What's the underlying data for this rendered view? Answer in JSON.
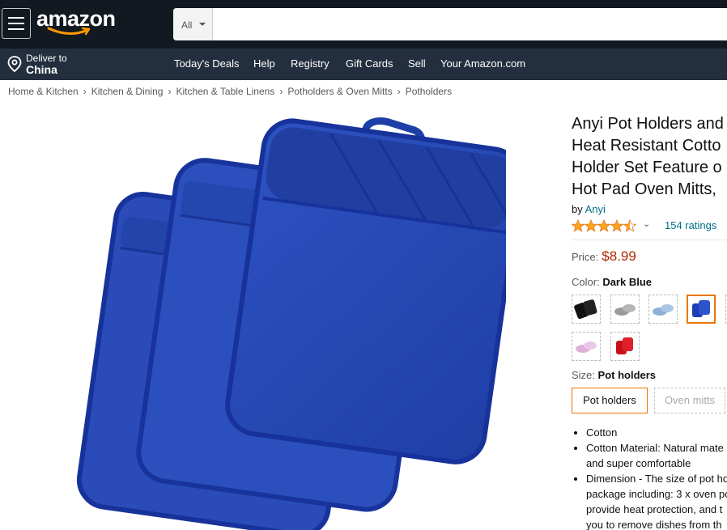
{
  "header": {
    "logo": "amazon",
    "search_category": "All",
    "search_placeholder": "",
    "deliver_line1": "Deliver to",
    "deliver_line2": "China",
    "nav": [
      "Today's Deals",
      "Help",
      "Registry",
      "Gift Cards",
      "Sell",
      "Your Amazon.com"
    ]
  },
  "breadcrumbs": [
    "Home & Kitchen",
    "Kitchen & Dining",
    "Kitchen & Table Linens",
    "Potholders & Oven Mitts",
    "Potholders"
  ],
  "product": {
    "title_lines": [
      "Anyi Pot Holders and",
      "Heat Resistant Cotto",
      "Holder Set Feature o",
      "Hot Pad Oven Mitts,"
    ],
    "by_prefix": "by",
    "brand": "Anyi",
    "rating_stars": 4.5,
    "ratings_count": "154 ratings",
    "price_label": "Price:",
    "price": "$8.99",
    "color_label": "Color:",
    "color_value": "Dark Blue",
    "swatches": [
      {
        "name": "black",
        "color": "#111111"
      },
      {
        "name": "gray",
        "color": "#9a9a9a"
      },
      {
        "name": "light-blue",
        "color": "#9ab6d8"
      },
      {
        "name": "dark-blue",
        "color": "#1c3fb8",
        "selected": true
      },
      {
        "name": "partial",
        "color": "#e9e9e9"
      },
      {
        "name": "pink",
        "color": "#e3b9e0"
      },
      {
        "name": "red",
        "color": "#d3121c"
      }
    ],
    "size_label": "Size:",
    "size_value": "Pot holders",
    "size_options": [
      "Pot holders",
      "Oven mitts"
    ],
    "bullets": [
      "Cotton",
      "Cotton Material: Natural mate",
      "and super comfortable",
      "Dimension - The size of pot ho",
      "package including: 3 x oven po",
      "provide heat protection, and t",
      "you to remove dishes from th"
    ]
  },
  "colors": {
    "header": "#131921",
    "subheader": "#232f3e",
    "link": "#007185",
    "price": "#b12704",
    "star": "#ffa41c",
    "accent": "#e77600",
    "product": "#2347b3"
  }
}
